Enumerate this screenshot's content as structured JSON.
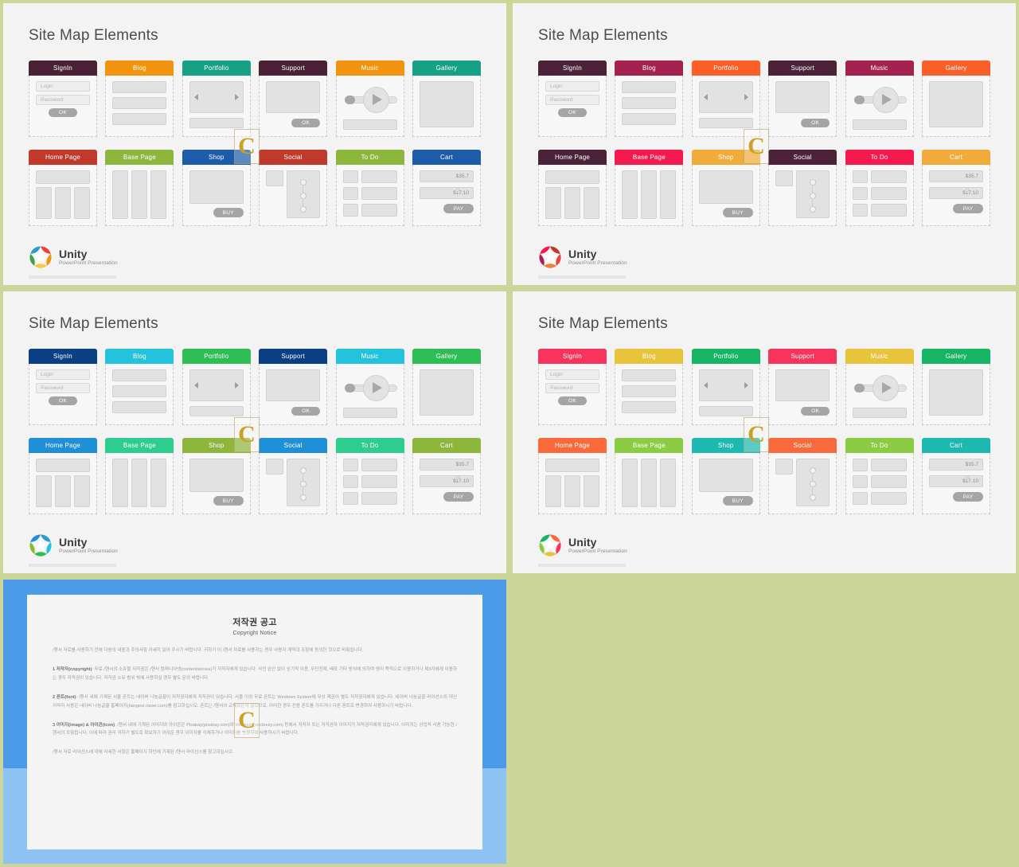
{
  "page": {
    "background": "#cdd69a",
    "watermark_glyph": "C"
  },
  "common": {
    "slide_title": "Site Map Elements",
    "logo": {
      "brand": "Unity",
      "subtitle": "PowerPoint Presentation"
    },
    "cards_row1": [
      {
        "key": "signin",
        "label": "SignIn"
      },
      {
        "key": "blog",
        "label": "Blog"
      },
      {
        "key": "portfolio",
        "label": "Portfolio"
      },
      {
        "key": "support",
        "label": "Support"
      },
      {
        "key": "music",
        "label": "Music"
      },
      {
        "key": "gallery",
        "label": "Gallery"
      }
    ],
    "cards_row2": [
      {
        "key": "home",
        "label": "Home Page"
      },
      {
        "key": "base",
        "label": "Base Page"
      },
      {
        "key": "shop",
        "label": "Shop"
      },
      {
        "key": "social",
        "label": "Social"
      },
      {
        "key": "todo",
        "label": "To Do"
      },
      {
        "key": "cart",
        "label": "Cart"
      }
    ],
    "labels": {
      "login": "Login",
      "password": "Password",
      "ok": "OK",
      "buy": "BUY",
      "pay": "PAY",
      "price1": "$35.7",
      "price2": "$17.10"
    }
  },
  "slides": [
    {
      "id": "slide-1",
      "title": "Site Map Elements",
      "palette_name": "earth",
      "row1_colors": [
        "#4b2235",
        "#f2930d",
        "#16a085",
        "#4b2235",
        "#f2930d",
        "#16a085"
      ],
      "row2_colors": [
        "#c0392b",
        "#8cb63c",
        "#1c5ca8",
        "#c0392b",
        "#8cb63c",
        "#1c5ca8"
      ],
      "logo_colors": [
        "#e8453c",
        "#f2930d",
        "#f7c948",
        "#3fa14a",
        "#2e9ad0"
      ]
    },
    {
      "id": "slide-2",
      "title": "Site Map Elements",
      "palette_name": "plum",
      "row1_colors": [
        "#4b2238",
        "#a52250",
        "#fb5e26",
        "#4b2238",
        "#a52250",
        "#fb5e26"
      ],
      "row2_colors": [
        "#4b2238",
        "#f5194e",
        "#f0ab3a",
        "#4b2238",
        "#f5194e",
        "#f0ab3a"
      ],
      "logo_colors": [
        "#c0392b",
        "#e8453c",
        "#f07f3c",
        "#a52250",
        "#f5194e"
      ]
    },
    {
      "id": "slide-3",
      "title": "Site Map Elements",
      "palette_name": "ocean",
      "row1_colors": [
        "#0b3f84",
        "#23c3dd",
        "#2fbd56",
        "#0b3f84",
        "#23c3dd",
        "#2fbd56"
      ],
      "row2_colors": [
        "#1f8fd8",
        "#2ecc8f",
        "#8cb63c",
        "#1f8fd8",
        "#2ecc8f",
        "#8cb63c"
      ],
      "logo_colors": [
        "#2e9ad0",
        "#23c3dd",
        "#2fbd56",
        "#8cb63c",
        "#1f8fd8"
      ]
    },
    {
      "id": "slide-4",
      "title": "Site Map Elements",
      "palette_name": "citrus",
      "row1_colors": [
        "#f8335c",
        "#e8c33c",
        "#16b563",
        "#f8335c",
        "#e8c33c",
        "#16b563"
      ],
      "row2_colors": [
        "#f86a3c",
        "#8ccc44",
        "#1db8b0",
        "#f86a3c",
        "#8ccc44",
        "#1db8b0"
      ],
      "logo_colors": [
        "#f86a3c",
        "#f8335c",
        "#e8c33c",
        "#8ccc44",
        "#16b563"
      ]
    }
  ],
  "copyright_slide": {
    "heading_ko": "저작권 공고",
    "heading_en": "Copyright Notice",
    "paragraphs": [
      "/핸서 자료를 사용하기 전에 다음의 내용과 주의사항 자세히 읽어 주시기 바랍니다. 귀하가 이 /핸서 자료를 사용하는 경우 사용자 계약과 조항에 동의한 것으로 비춰집니다.",
      "<b>1 저작자(copyright)</b>: 무료 /핸서의 소유물 저작권은 /핸서 컴퍼니아넷(contentskorea)가 저작자에게 있습니다. 사전 승인 없이 상기적 이용, 무단전재, 배포 기타 방식에 의하여 영리 목적으로 이용하거나 제3자에게 이용하는 경우 저작권이 있습니다. 저작권 소유 범위 밖에 사용하실 경우 별도 문의 바랍니다.",
      "<b>2 폰트(font)</b>: /핸서 내에 기재된 서울 폰트는 네이버 나눔글꼴이 저작권자에게 저작권이 있습니다. 서울 이외 무료 폰트는 Windows System에 무상 제공이 별도 저작권자에게 있습니다. 네이버 나눔글꼴 라이선스의 대신 저작자 사용은 네이버 나눔글꼴 홈페이지(hangeul.naver.com)를 참고하십시오. 폰트는 /핸서의 교체되는지 않으므로, 이러한 경우 전용 폰트를 가지거나 다른 폰트로 변경하여 사용하시기 바랍니다.",
      "<b>3 이미지(image) &amp; 아이콘(icon)</b>: /핸서 내에 기재된 이미지와 아이콘은 Pixabay(pixabay.com)와 Vecteezy(vecteezy.com) 등에서 저작자 또는 저작권자 이미지가 저작권자에게 있습니다. 이미지는 상업적 사용 가능한 /핸서의 포함됩니다. 이에 따라 권리 귀하가 별도로 확보하기 어려운 경우 이미지를 삭제하거나 이미지를 변경하여 사용하시기 바랍니다.",
      "/핸서 자료 라이선스에 대해 자세한 사항은 홈페이지 하단에 기재된 /핸서 라이선스를 참고하십시오."
    ]
  }
}
